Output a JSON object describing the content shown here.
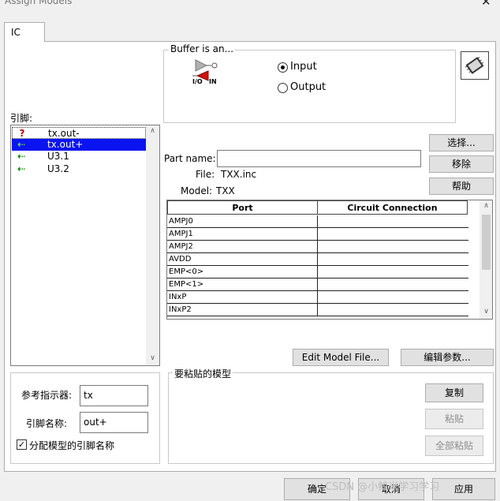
{
  "window": {
    "title": "Assign Models",
    "close_glyph": "✕"
  },
  "tab": {
    "label": "IC"
  },
  "buffer": {
    "legend": "Buffer is an...",
    "io_label": "I/O",
    "in_label": "IN",
    "input_label": "Input",
    "output_label": "Output",
    "selected": "Input"
  },
  "pins": {
    "label": "引脚:",
    "items": [
      {
        "icon": "?",
        "icon_name": "question-icon",
        "name": "tx.out-",
        "selected": false
      },
      {
        "icon": "⇠",
        "icon_name": "arrow-left-icon",
        "name": "tx.out+",
        "selected": true
      },
      {
        "icon": "⇠",
        "icon_name": "arrow-left-icon",
        "name": "U3.1",
        "selected": false
      },
      {
        "icon": "⇠",
        "icon_name": "arrow-left-icon",
        "name": "U3.2",
        "selected": false
      }
    ]
  },
  "part": {
    "name_label": "Part name:",
    "name_value": "",
    "file_label": "File:",
    "file_value": "TXX.inc",
    "model_label": "Model:",
    "model_value": "TXX"
  },
  "buttons": {
    "select": "选择...",
    "remove": "移除",
    "help": "帮助",
    "edit_model": "Edit Model File...",
    "edit_params": "编辑参数...",
    "copy": "复制",
    "paste": "粘贴",
    "paste_all": "全部粘贴",
    "ok": "确定",
    "cancel": "取消",
    "apply": "应用"
  },
  "table": {
    "headers": [
      "Port",
      "Circuit Connection"
    ],
    "rows": [
      "AMPJ0",
      "AMPJ1",
      "AMPJ2",
      "AVDD",
      "EMP<0>",
      "EMP<1>",
      "INxP",
      "INxP2"
    ]
  },
  "ref": {
    "designator_label": "参考指示器:",
    "designator_value": "tx",
    "pin_name_label": "引脚名称:",
    "pin_name_value": "out+",
    "assign_label": "分配模型的引脚名称",
    "assign_checked": true
  },
  "paste_group": {
    "legend": "要粘贴的模型"
  },
  "watermark": "CSDN @小鲸米学习学习"
}
